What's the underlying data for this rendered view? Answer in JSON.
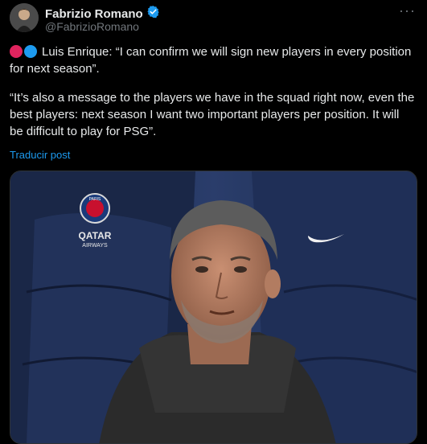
{
  "tweet": {
    "author": {
      "display_name": "Fabrizio Romano",
      "handle": "@FabrizioRomano",
      "verified": true
    },
    "more_label": "···",
    "emoji_dots": [
      "#e0245e",
      "#1d9bf0"
    ],
    "paragraphs": [
      "Luis Enrique: “I can confirm we will sign new players in every position for next season”.",
      "“It’s also a message to the players we have in the squad right now, even the best players: next season I want two important players per position. It will be difficult to play for PSG”."
    ],
    "translate_label": "Traducir post",
    "media": {
      "sponsor_text_top": "QATAR",
      "sponsor_text_bottom": "AIRWAYS",
      "crest_text": "PARIS"
    }
  },
  "colors": {
    "background": "#000000",
    "text": "#e7e9ea",
    "muted": "#71767b",
    "link": "#1d9bf0"
  }
}
